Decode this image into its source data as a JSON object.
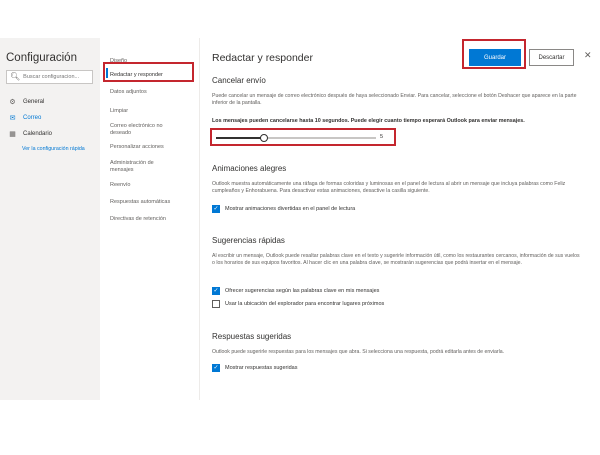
{
  "left": {
    "title": "Configuración",
    "search_placeholder": "Buscar configuracion...",
    "items": [
      {
        "label": "General",
        "icon": "gear-icon"
      },
      {
        "label": "Correo",
        "icon": "mail-icon"
      },
      {
        "label": "Calendario",
        "icon": "calendar-icon"
      }
    ],
    "view_link": "Ver la configuración rápida"
  },
  "middle": {
    "items": [
      "Diseño",
      "Redactar y responder",
      "Datos adjuntos",
      "Limpiar",
      "Correo electrónico no deseado",
      "Personalizar acciones",
      "Administración de mensajes",
      "Reenvío",
      "Respuestas automáticas",
      "Directivas de retención"
    ],
    "selected_index": 1
  },
  "right": {
    "title": "Redactar y responder",
    "save_label": "Guardar",
    "discard_label": "Descartar",
    "close_glyph": "✕",
    "undo": {
      "title": "Cancelar envío",
      "desc": "Puede cancelar un mensaje de correo electrónico después de haya seleccionado Enviar. Para cancelar, seleccione el botón Deshacer que aparece en la parte inferior de la pantalla.",
      "strong": "Los mensajes pueden cancelarse hasta 10 segundos. Puede elegir cuanto tiempo esperará Outlook para enviar mensajes.",
      "slider_value": 5,
      "slider_max": 10
    },
    "joyful": {
      "title": "Animaciones alegres",
      "desc": "Outlook muestra automáticamente una ráfaga de formas coloridas y luminosas en el panel de lectura al abrir un mensaje que incluya palabras como Feliz cumpleaños y Enhorabuena. Para desactivar estas animaciones, desactive la casilla siguiente.",
      "check": "Mostrar animaciones divertidas en el panel de lectura"
    },
    "suggestions": {
      "title": "Sugerencias rápidas",
      "desc": "Al escribir un mensaje, Outlook puede resaltar palabras clave en el texto y sugerirle información útil, como los restaurantes cercanos, información de sus vuelos o los horarios de sus equipos favoritos. Al hacer clic en una palabra clave, se mostrarán sugerencias que podrá insertar en el mensaje.",
      "check1": "Ofrecer sugerencias según las palabras clave en mis mensajes",
      "check2": "Usar la ubicación del explorador para encontrar lugares próximos"
    },
    "replies": {
      "title": "Respuestas sugeridas",
      "desc": "Outlook puede sugerirle respuestas para los mensajes que abra. Si selecciona una respuesta, podrá editarla antes de enviarla.",
      "check": "Mostrar respuestas sugeridas"
    }
  }
}
